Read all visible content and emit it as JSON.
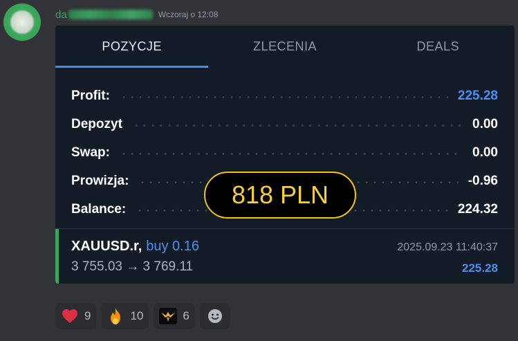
{
  "message": {
    "username_visible": "da",
    "timestamp": "Wczoraj o 12:08"
  },
  "card": {
    "tabs": [
      {
        "label": "POZYCJE",
        "active": true
      },
      {
        "label": "ZLECENIA",
        "active": false
      },
      {
        "label": "DEALS",
        "active": false
      }
    ],
    "summary": [
      {
        "label": "Profit:",
        "value": "225.28"
      },
      {
        "label": "Depozyt",
        "value": "0.00"
      },
      {
        "label": "Swap:",
        "value": "0.00"
      },
      {
        "label": "Prowizja:",
        "value": "-0.96"
      },
      {
        "label": "Balance:",
        "value": "224.32"
      }
    ],
    "overlay_badge": "818 PLN",
    "position": {
      "symbol": "XAUUSD.r,",
      "side": "buy 0.16",
      "open_price": "3 755.03",
      "arrow": "→",
      "close_price": "3 769.11",
      "time": "2025.09.23 11:40:37",
      "profit": "225.28"
    }
  },
  "reactions": [
    {
      "icon": "heart-icon",
      "count": "9"
    },
    {
      "icon": "fire-icon",
      "count": "10"
    },
    {
      "icon": "bird-emoji-icon",
      "count": "6"
    },
    {
      "icon": "add-reaction-smiley-icon"
    }
  ],
  "colors": {
    "background": "#313338",
    "card": "#121b26",
    "accent_blue": "#4a8ff0",
    "accent_green": "#3ba55c",
    "badge_gold": "#f1c40f"
  }
}
